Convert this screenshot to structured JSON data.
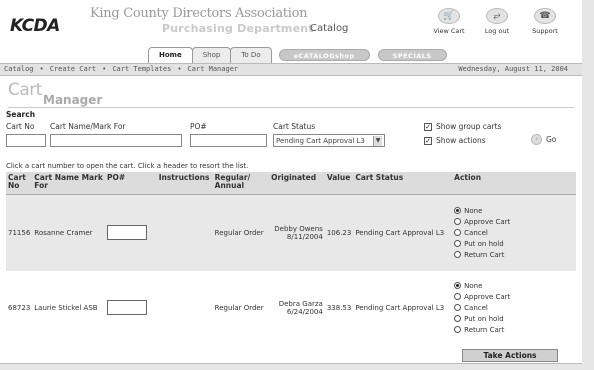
{
  "header": {
    "logo": "KCDA",
    "association": "King County Directors Association",
    "department": "Purchasing Department",
    "catalog_word": "Catalog",
    "icons": [
      {
        "name": "view-cart-icon",
        "glyph": "🛒",
        "label": "View Cart"
      },
      {
        "name": "log-out-icon",
        "glyph": "⥂",
        "label": "Log out"
      },
      {
        "name": "support-icon",
        "glyph": "☎",
        "label": "Support"
      }
    ]
  },
  "tabs": {
    "home": "Home",
    "shop": "Shop",
    "todo": "To Do",
    "ecatalog": "eCATALOGshop",
    "specials": "SPECIALS"
  },
  "breadcrumb": {
    "items": [
      "Catalog",
      "Create Cart",
      "Cart Templates",
      "Cart Manager"
    ],
    "separator": "•",
    "date": "Wednesday, August 11, 2004"
  },
  "title": {
    "part1": "Cart",
    "part2": "Manager"
  },
  "search": {
    "heading": "Search",
    "cart_no_label": "Cart No",
    "cart_name_label": "Cart Name/Mark For",
    "po_label": "PO#",
    "status_label": "Cart Status",
    "cart_no_value": "",
    "cart_name_value": "",
    "po_value": "",
    "status_value": "Pending Cart Approval L3",
    "show_group_carts": "Show group carts",
    "show_actions": "Show actions",
    "go": "Go"
  },
  "note": "Click a cart number to open the cart. Click a header to resort the list.",
  "table": {
    "headers": {
      "cart_no": "Cart No",
      "cart_name": "Cart Name Mark For",
      "po": "PO#",
      "instructions": "Instructions",
      "regular": "Regular/ Annual",
      "originated": "Originated",
      "value": "Value",
      "status": "Cart Status",
      "action": "Action"
    },
    "rows": [
      {
        "cart_no": "71156",
        "cart_name": "Rosanne Cramer",
        "po": "",
        "instructions": "",
        "regular": "Regular Order",
        "originated_by": "Debby Owens",
        "originated_date": "8/11/2004",
        "value": "106.23",
        "status": "Pending Cart Approval L3"
      },
      {
        "cart_no": "68723",
        "cart_name": "Laurie Stickel ASB",
        "po": "",
        "instructions": "",
        "regular": "Regular Order",
        "originated_by": "Debra Garza",
        "originated_date": "6/24/2004",
        "value": "338.53",
        "status": "Pending Cart Approval L3"
      }
    ],
    "actions": [
      "None",
      "Approve Cart",
      "Cancel",
      "Put on hold",
      "Return Cart"
    ]
  },
  "take_actions": "Take Actions"
}
